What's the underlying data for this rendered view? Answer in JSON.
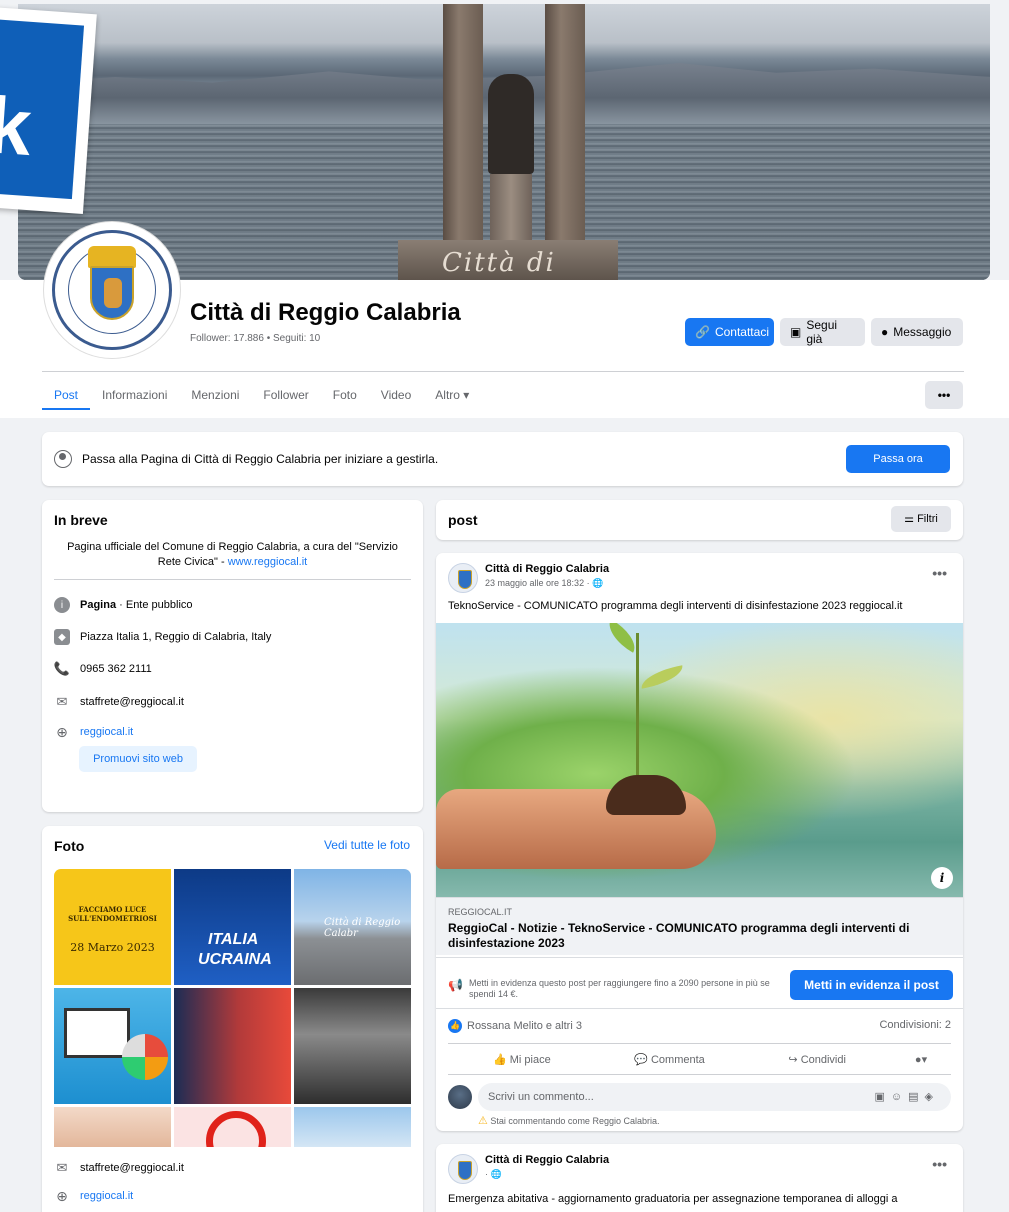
{
  "cover": {
    "overlay_text": "Città di"
  },
  "page": {
    "name": "Città di Reggio Calabria",
    "followers_text": "Follower: 17.886 • Seguiti: 10"
  },
  "header_buttons": {
    "contact": "Contattaci",
    "following": "Segui già",
    "message": "Messaggio"
  },
  "tabs": [
    "Post",
    "Informazioni",
    "Menzioni",
    "Follower",
    "Foto",
    "Video",
    "Altro ▾"
  ],
  "tab_more": "•••",
  "banner": {
    "text": "Passa alla Pagina di Città di Reggio Calabria per iniziare a gestirla.",
    "button": "Passa ora"
  },
  "intro": {
    "title": "In breve",
    "bio": "Pagina ufficiale del Comune di Reggio Calabria, a cura del \"Servizio Rete Civica\" - ",
    "bio_link": "www.reggiocal.it",
    "category_label": "Pagina",
    "category_value": " · Ente pubblico",
    "address": "Piazza Italia 1, Reggio di Calabria, Italy",
    "phone": "0965 362 2111",
    "email": "staffrete@reggiocal.it",
    "website": "reggiocal.it",
    "promote_button": "Promuovi sito web"
  },
  "photos": {
    "title": "Foto",
    "see_all": "Vedi tutte le foto",
    "photo1_title": "FACCIAMO LUCE SULL'ENDOMETRIOSI",
    "photo1_date": "28 Marzo 2023",
    "photo2_line1": "ITALIA",
    "photo2_line2": "UCRAINA",
    "photo3_text": "Città di Reggio Calabr",
    "email": "staffrete@reggiocal.it",
    "website": "reggiocal.it"
  },
  "feed": {
    "title": "post",
    "filter_button": "Filtri"
  },
  "post1": {
    "author": "Città di Reggio Calabria",
    "date": "23 maggio alle ore 18:32 · 🌐",
    "text": "TeknoService - COMUNICATO programma degli interventi di disinfestazione 2023 reggiocal.it",
    "link_domain": "REGGIOCAL.IT",
    "link_title": "ReggioCal - Notizie - TeknoService - COMUNICATO programma degli interventi di disinfestazione 2023",
    "boost_text": "Metti in evidenza questo post per raggiungere fino a 2090 persone in più se spendi 14 €.",
    "boost_button": "Metti in evidenza il post",
    "reactions": "Rossana Melito e altri 3",
    "shares": "Condivisioni: 2",
    "like": "Mi piace",
    "comment": "Commenta",
    "share": "Condividi",
    "comment_placeholder": "Scrivi un commento...",
    "commenting_as": "Stai commentando come Reggio Calabria."
  },
  "post2": {
    "author": "Città di Reggio Calabria",
    "date": "· 🌐",
    "text": "Emergenza abitativa - aggiornamento graduatoria per assegnazione temporanea di alloggi a"
  },
  "colors": {
    "primary": "#1877f2",
    "background": "#f0f2f5",
    "secondary_text": "#65676b"
  }
}
